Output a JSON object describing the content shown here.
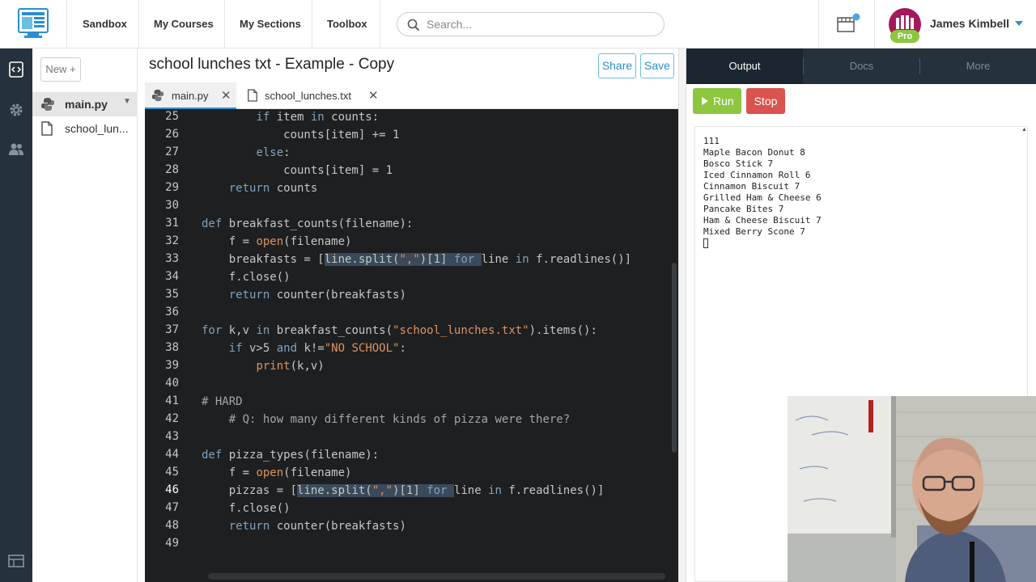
{
  "nav": {
    "links": [
      "Sandbox",
      "My Courses",
      "My Sections",
      "Toolbox"
    ],
    "search_placeholder": "Search...",
    "user_name": "James Kimbell",
    "pro_label": "Pro"
  },
  "sidebar": {
    "new_label": "New +",
    "files": [
      {
        "name": "main.py",
        "active": true
      },
      {
        "name": "school_lun...",
        "active": false
      }
    ]
  },
  "project": {
    "title": "school lunches txt - Example - Copy",
    "share_label": "Share",
    "save_label": "Save"
  },
  "tabs": [
    {
      "name": "main.py",
      "active": true
    },
    {
      "name": "school_lunches.txt",
      "active": false
    }
  ],
  "editor": {
    "current_line": 46,
    "line_numbers": [
      25,
      26,
      27,
      28,
      29,
      30,
      31,
      32,
      33,
      34,
      35,
      36,
      37,
      38,
      39,
      40,
      41,
      42,
      43,
      44,
      45,
      46,
      47,
      48,
      49
    ],
    "code": {
      "l25": "if item in counts:",
      "l26": "counts[item] += 1",
      "l27": "else:",
      "l28": "counts[item] = 1",
      "l29": "return counts",
      "l31": "def breakfast_counts(filename):",
      "l32": "f = open(filename)",
      "l33": "breakfasts = [line.split(\",\")[1] for line in f.readlines()]",
      "l34": "f.close()",
      "l35": "return counter(breakfasts)",
      "l37": "for k,v in breakfast_counts(\"school_lunches.txt\").items():",
      "l38": "if v>5 and k!=\"NO SCHOOL\":",
      "l39": "print(k,v)",
      "l41": "# HARD",
      "l42": "# Q: how many different kinds of pizza were there?",
      "l44": "def pizza_types(filename):",
      "l45": "f = open(filename)",
      "l46": "pizzas = [line.split(\",\")[1] for line in f.readlines()]",
      "l47": "f.close()",
      "l48": "return counter(breakfasts)"
    }
  },
  "output_panel": {
    "tabs": [
      "Output",
      "Docs",
      "More"
    ],
    "run_label": "Run",
    "stop_label": "Stop",
    "lines": [
      "111",
      "Maple Bacon Donut 8",
      "Bosco Stick 7",
      "Iced Cinnamon Roll 6",
      "Cinnamon Biscuit 7",
      "Grilled Ham & Cheese 6",
      "Pancake Bites 7",
      "Ham & Cheese Biscuit 7",
      "Mixed Berry Scone 7"
    ]
  },
  "colors": {
    "accent": "#2a8fd0",
    "run": "#8dc63f",
    "stop": "#d9534f",
    "rail": "#25313d",
    "editor_bg": "#1d1f21"
  }
}
